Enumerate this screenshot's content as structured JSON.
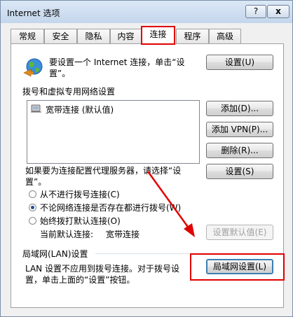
{
  "window": {
    "title": "Internet 选项",
    "help_label": "?",
    "close_label": "x"
  },
  "tabs": [
    {
      "label": "常规"
    },
    {
      "label": "安全"
    },
    {
      "label": "隐私"
    },
    {
      "label": "内容"
    },
    {
      "label": "连接",
      "active": true
    },
    {
      "label": "程序"
    },
    {
      "label": "高级"
    }
  ],
  "setup": {
    "text_line1": "要设置一个 Internet 连接，单击“设",
    "text_line2": "置”。",
    "button": "设置(U)"
  },
  "dialup": {
    "heading": "拨号和虚拟专用网络设置",
    "items": [
      {
        "label": "宽带连接 (默认值)"
      }
    ],
    "add_button": "添加(D)...",
    "add_vpn_button": "添加 VPN(P)...",
    "remove_button": "删除(R)...",
    "proxy_text_line1": "如果要为连接配置代理服务器，请选择“设",
    "proxy_text_line2": "置”。",
    "settings_button": "设置(S)",
    "radio_options": [
      {
        "label": "从不进行拨号连接(C)",
        "checked": false
      },
      {
        "label": "不论网络连接是否存在都进行拨号(W)",
        "checked": true
      },
      {
        "label": "始终拨打默认连接(O)",
        "checked": false
      }
    ],
    "current_default_label": "当前默认连接:",
    "current_default_value": "宽带连接",
    "set_default_button": "设置默认值(E)"
  },
  "lan": {
    "heading": "局域网(LAN)设置",
    "text_line1": "LAN 设置不应用到拨号连接。对于拨号设",
    "text_line2": "置，单击上面的“设置”按钮。",
    "button": "局域网设置(L)"
  },
  "colors": {
    "highlight_red": "#e00000",
    "focus_blue": "#3c7fb1"
  }
}
